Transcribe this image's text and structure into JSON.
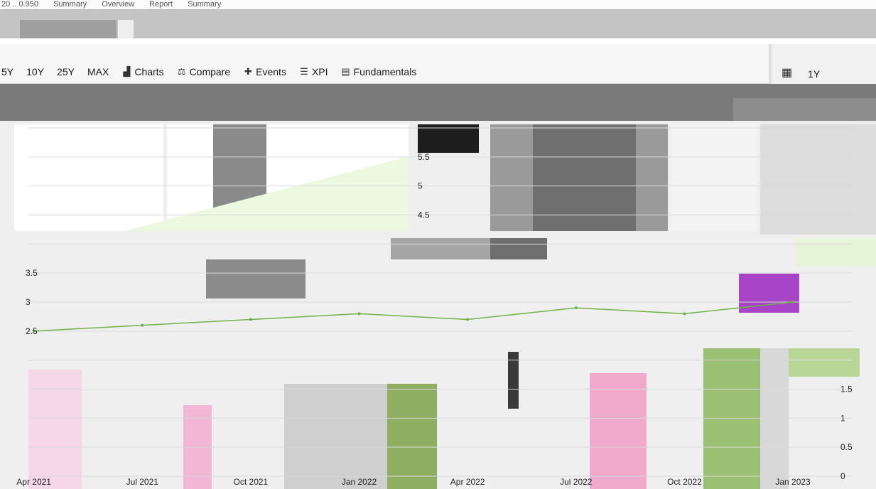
{
  "topbar": {
    "items": [
      "20 .. 0.950",
      "Summary",
      "Overview",
      "Report",
      "Summary"
    ]
  },
  "toolbar": {
    "ranges": [
      "5Y",
      "10Y",
      "25Y",
      "MAX"
    ],
    "actions": [
      {
        "label": "Charts",
        "icon": "chart-icon"
      },
      {
        "label": "Compare",
        "icon": "compare-icon"
      },
      {
        "label": "Events",
        "icon": "events-icon"
      },
      {
        "label": "XPI",
        "icon": "indicator-icon"
      },
      {
        "label": "Fundamentals",
        "icon": "fundamentals-icon"
      }
    ],
    "right_label": "1Y",
    "right_icon": "calendar-icon"
  },
  "chart_data": {
    "type": "line",
    "title": "",
    "xlabel": "",
    "ylabel": "",
    "x_ticks": [
      "Apr 2021",
      "Jul 2021",
      "Oct 2021",
      "Jan 2022",
      "Apr 2022",
      "Jul 2022",
      "Oct 2022",
      "Jan 2023"
    ],
    "ylim": [
      0,
      6
    ],
    "y_ticks_right": [
      "0",
      "0.5",
      "1",
      "1.5"
    ],
    "y_ticks_upper": [
      "4.5",
      "5",
      "5.5"
    ],
    "y_ticks_mid": [
      "2.5",
      "3",
      "3.5"
    ],
    "series": [
      {
        "color": "#6fb24a",
        "x": [
          "Apr 2021",
          "Jul 2021",
          "Oct 2021",
          "Jan 2022",
          "Apr 2022",
          "Jul 2022",
          "Oct 2022",
          "Jan 2023"
        ],
        "values": [
          2.5,
          2.6,
          2.7,
          2.8,
          2.7,
          2.9,
          2.8,
          3.0
        ]
      }
    ],
    "grid": true,
    "legend": "none"
  }
}
